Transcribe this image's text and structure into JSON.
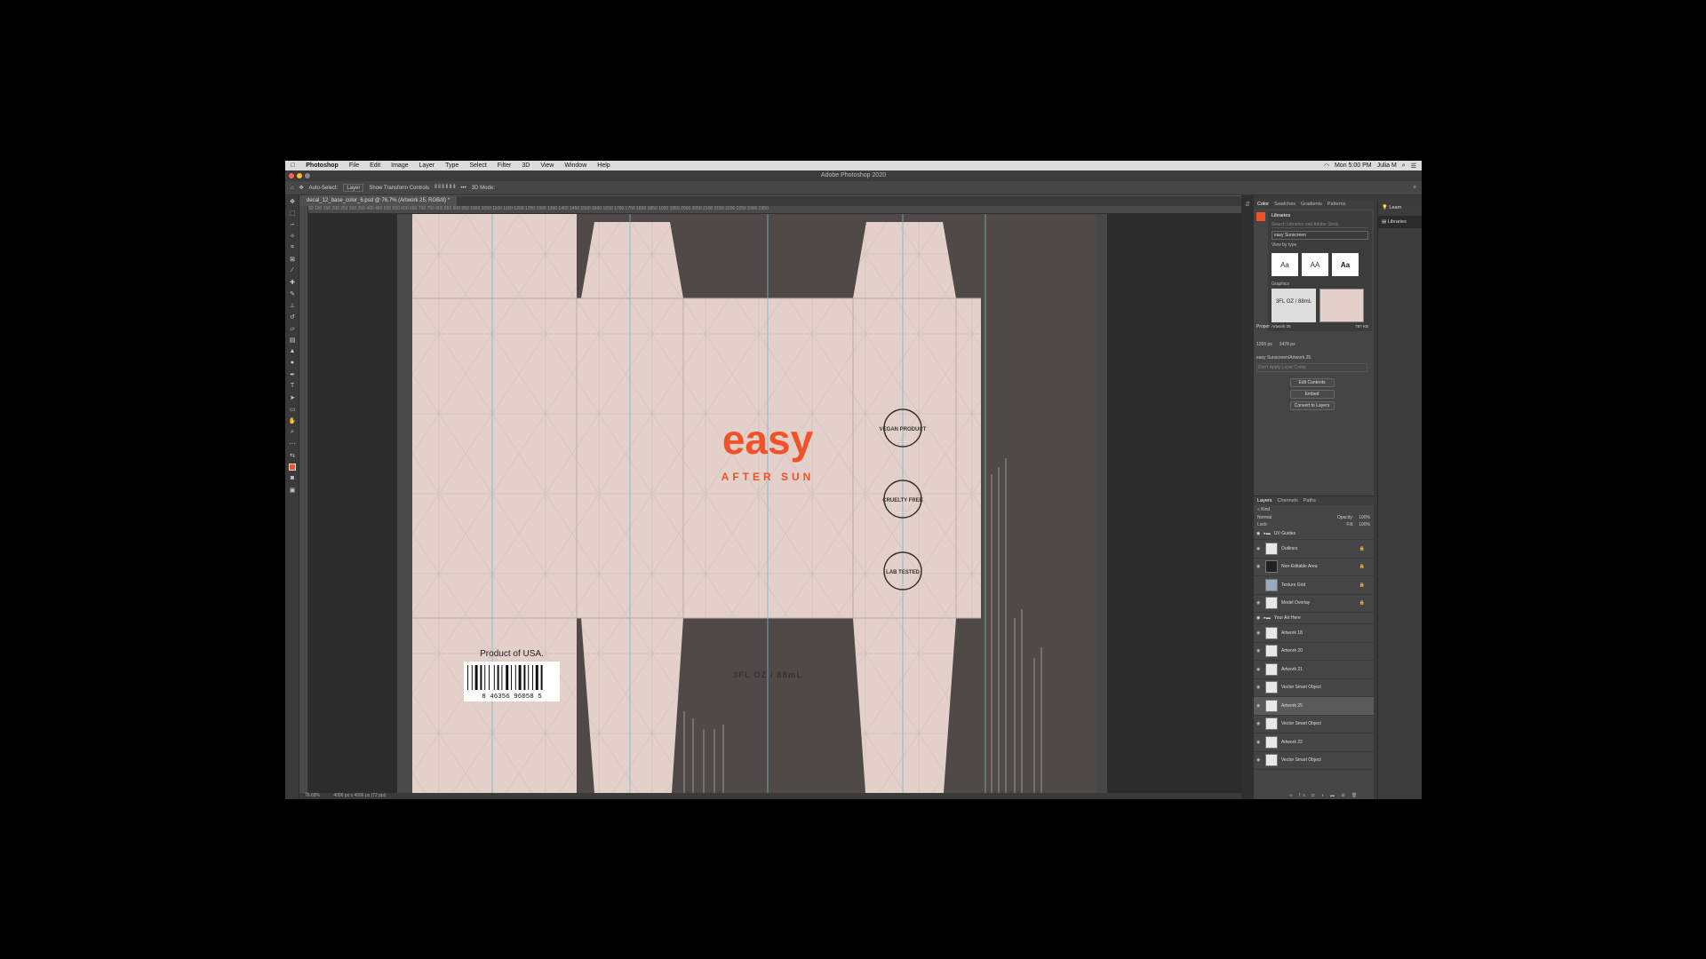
{
  "menubar": {
    "apple": "",
    "app": "Photoshop",
    "items": [
      "File",
      "Edit",
      "Image",
      "Layer",
      "Type",
      "Select",
      "Filter",
      "3D",
      "View",
      "Window",
      "Help"
    ],
    "clock": "Mon 5:00 PM",
    "user": "Julia M"
  },
  "window": {
    "title": "Adobe Photoshop 2020"
  },
  "options": {
    "auto_select": "Auto-Select:",
    "auto_select_value": "Layer",
    "transform": "Show Transform Controls",
    "mode3d": "3D Mode:"
  },
  "document": {
    "tab": "decal_12_base_color_6.psd @ 76.7% (Artwork 25, RGB/8) *",
    "ruler_ticks": "50 100 150 200 250 300 350 400 450 500 550 600 650 700 750 800 850 900 950 1000 1050 1100 1150 1200 1250 1300 1350 1400 1450 1500 1600 1650 1700 1750 1800 1850 1900 1950 2000 2050 2100 2150 2200 2250 2300 2350"
  },
  "artwork": {
    "brand": "easy",
    "subtitle": "AFTER SUN",
    "volume": "3FL OZ / 88mL",
    "origin": "Product of USA.",
    "barcode": "8  46356   96058   5",
    "badges": [
      "VEGAN PRODUCT",
      "CRUELTY FREE",
      "LAB TESTED"
    ],
    "brand_color": "#f0522a",
    "packaging_color": "#e3d0ca"
  },
  "status": {
    "zoom": "76.68%",
    "size": "4096 px x 4096 px (72 ppi)"
  },
  "panels": {
    "top_tabs": [
      "Color",
      "Swatches",
      "Gradients",
      "Patterns"
    ],
    "libraries_label": "Libraries",
    "search_placeholder": "Search Libraries and Adobe Stock",
    "library_name": "easy Sunscreen",
    "view_by": "View by type",
    "char_styles": [
      "Aa",
      "AA",
      "Aa"
    ],
    "graphics_label": "Graphics",
    "graphic_thumb_text": "3FL OZ / 88mL",
    "graphic_name": "Artwork 25",
    "graphic_size": "787 KB",
    "properties_label": "Proper",
    "w_value": "1265 px",
    "h_value": "3478 px",
    "smart_object_path": "easy Sunscreen/Artwork 25",
    "comps_placeholder": "Don't Apply Layer Comp",
    "edit_contents": "Edit Contents",
    "embed": "Embed",
    "convert": "Convert to Layers",
    "learn": "Learn",
    "libraries_side": "Libraries"
  },
  "layers": {
    "tabs": [
      "Layers",
      "Channels",
      "Paths"
    ],
    "kind": "Kind",
    "blend": "Normal",
    "opacity_label": "Opacity:",
    "opacity": "100%",
    "lock_label": "Lock:",
    "fill_label": "Fill:",
    "fill": "100%",
    "group1": "UV Guides",
    "group1_layers": [
      "Outlines",
      "Non-Editable Area",
      "Texture Grid",
      "Model Overlay"
    ],
    "group2": "Your Art Here",
    "group2_layers": [
      "Artwork 18",
      "Artwork 20",
      "Artwork 21",
      "Vector Smart Object",
      "Artwork 25",
      "Vector Smart Object",
      "Artwork 22",
      "Vector Smart Object"
    ],
    "selected": "Artwork 25"
  }
}
